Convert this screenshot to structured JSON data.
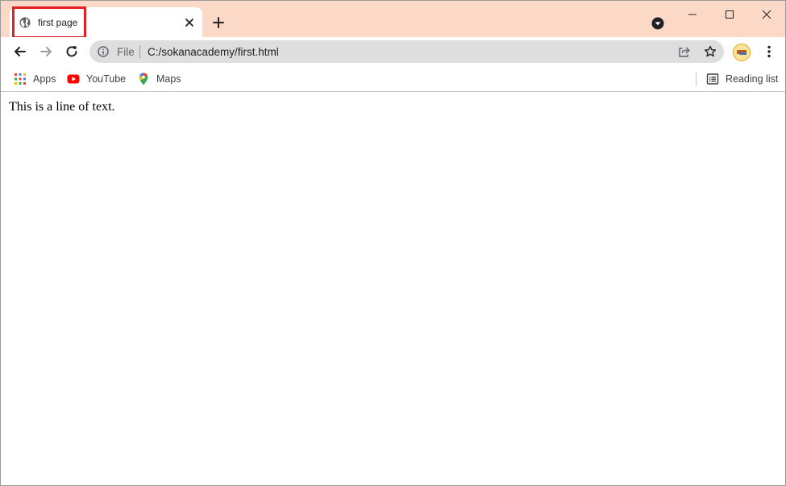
{
  "colors": {
    "frame": "#fcd9c6",
    "tab_highlight": "#e31f26",
    "omnibox_bg": "#dedede",
    "youtube_red": "#ff0000"
  },
  "tab": {
    "title": "first page",
    "favicon": "globe-icon"
  },
  "window_controls": {
    "icons": [
      "minimize-icon",
      "maximize-icon",
      "close-icon"
    ]
  },
  "toolbar": {
    "icons": [
      "back-arrow-icon",
      "forward-arrow-icon",
      "reload-icon"
    ]
  },
  "omnibox": {
    "scheme_label": "File",
    "url": "C:/sokanacademy/first.html",
    "icons": [
      "info-icon",
      "share-icon",
      "star-icon"
    ]
  },
  "bookmarks": {
    "items": [
      {
        "label": "Apps",
        "icon": "apps-grid-icon"
      },
      {
        "label": "YouTube",
        "icon": "youtube-icon"
      },
      {
        "label": "Maps",
        "icon": "maps-pin-icon"
      }
    ],
    "reading_list": {
      "label": "Reading list",
      "icon": "reading-list-icon"
    }
  },
  "page": {
    "text": "This is a line of text."
  }
}
